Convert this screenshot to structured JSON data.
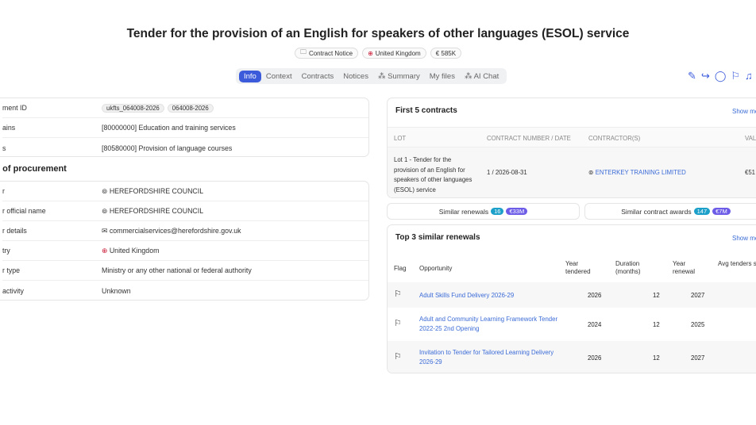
{
  "header": {
    "title": "Tender for the provision of an English for speakers of other languages (ESOL) service",
    "pills": [
      {
        "icon": "folder-icon",
        "label": "Contract Notice"
      },
      {
        "icon": "uk-flag-icon",
        "label": "United Kingdom"
      },
      {
        "icon": "euro-icon",
        "label": "€ 585K"
      }
    ]
  },
  "tabs": [
    "Info",
    "Context",
    "Contracts",
    "Notices",
    "Summary",
    "My files",
    "AI Chat"
  ],
  "left": {
    "rows_top": [
      {
        "key": "ment ID",
        "chips": [
          "ukfts_064008-2026",
          "064008-2026"
        ]
      },
      {
        "key": "ains",
        "link": "[80000000] Education and training services"
      },
      {
        "key": "s",
        "link": "[80580000] Provision of language courses"
      }
    ],
    "section": "e of procurement",
    "rows_proc": [
      {
        "key": "r",
        "link": "HEREFORDSHIRE COUNCIL",
        "icon": "org-icon"
      },
      {
        "key": "r official name",
        "link": "HEREFORDSHIRE COUNCIL",
        "icon": "org-icon"
      },
      {
        "key": "r details",
        "link": "commercialservices@herefordshire.gov.uk",
        "icon": "mail-icon"
      },
      {
        "key": "try",
        "value": "United Kingdom",
        "icon": "uk-flag-icon"
      },
      {
        "key": "r type",
        "value": "Ministry or any other national or federal authority"
      },
      {
        "key": "activity",
        "value": "Unknown"
      }
    ]
  },
  "contracts": {
    "title": "First 5 contracts",
    "show_more": "Show mo",
    "headers": [
      "LOT",
      "CONTRACT NUMBER / DATE",
      "CONTRACTOR(S)",
      "VAL"
    ],
    "rows": [
      {
        "lot": "Lot 1 - Tender for the provision of an English for speakers of other languages (ESOL) service",
        "number": "1 / 2026-08-31",
        "contractor": "ENTERKEY TRAINING LIMITED",
        "value": "€51"
      }
    ]
  },
  "similar": {
    "renewals_label": "Similar renewals",
    "renewals_count": "16",
    "renewals_value": "€33M",
    "awards_label": "Similar contract awards",
    "awards_count": "147",
    "awards_value": "€7M"
  },
  "renewals": {
    "title": "Top 3 similar renewals",
    "show_more": "Show mo",
    "headers": {
      "flag": "Flag",
      "opportunity": "Opportunity",
      "year_tendered": "Year tendered",
      "duration": "Duration (months)",
      "year_renewal": "Year renewal",
      "avg": "Avg tenders submitted"
    },
    "rows": [
      {
        "opportunity": "Adult Skills Fund Delivery 2026-29",
        "year": "2026",
        "duration": "12",
        "renewal": "2027"
      },
      {
        "opportunity": "Adult and Community Learning Framework Tender 2022-25 2nd Opening",
        "year": "2024",
        "duration": "12",
        "renewal": "2025"
      },
      {
        "opportunity": "Invitation to Tender for Tailored Learning Delivery 2026-29",
        "year": "2026",
        "duration": "12",
        "renewal": "2027"
      }
    ]
  },
  "colors": {
    "accent": "#3b5bdb",
    "link": "#3b6bd6",
    "badge_teal": "#1c9fc9",
    "badge_purple": "#6c5ce7"
  }
}
